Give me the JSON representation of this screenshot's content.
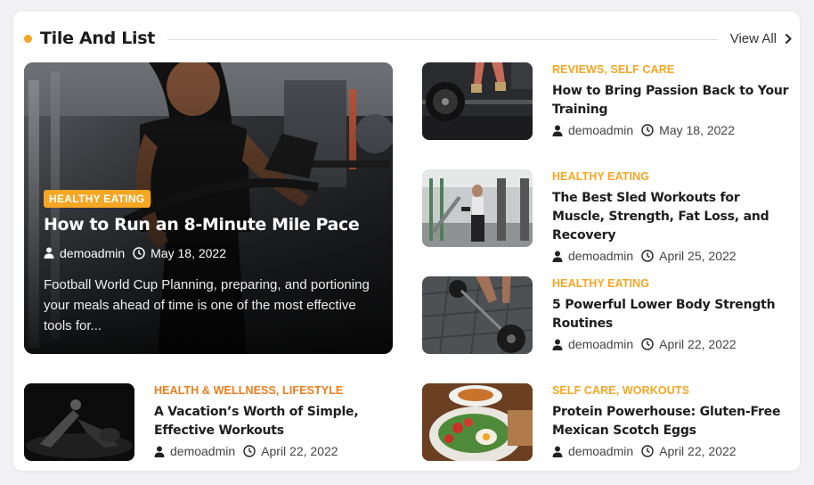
{
  "section": {
    "title": "Tile And List",
    "view_all": "View All",
    "accent_color": "#f5a623"
  },
  "featured": {
    "category": "HEALTHY EATING",
    "title": "How to Run an 8-Minute Mile Pace",
    "author": "demoadmin",
    "date": "May 18, 2022",
    "excerpt": "Football World Cup Planning, preparing, and portioning your meals ahead of time is one of the most effective tools for...",
    "image": "man-on-treadmill-photo"
  },
  "list": [
    {
      "categories": [
        "REVIEWS",
        "SELF CARE"
      ],
      "title": "How to Bring Passion Back to Your Training",
      "author": "demoadmin",
      "date": "May 18, 2022",
      "image": "barbell-deadlift-photo"
    },
    {
      "categories": [
        "HEALTHY EATING"
      ],
      "title": "The Best Sled Workouts for Muscle, Strength, Fat Loss, and Recovery",
      "author": "demoadmin",
      "date": "April 25, 2022",
      "image": "gym-woman-dumbbells-photo"
    },
    {
      "categories": [
        "HEALTHY EATING"
      ],
      "title": "5 Powerful Lower Body Strength Routines",
      "author": "demoadmin",
      "date": "April 22, 2022",
      "image": "barbell-floor-photo"
    },
    {
      "categories": [
        "HEALTH & WELLNESS",
        "LIFESTYLE"
      ],
      "title": "A Vacation’s Worth of Simple, Effective Workouts",
      "author": "demoadmin",
      "date": "April 22, 2022",
      "image": "dark-workout-photo"
    },
    {
      "categories": [
        "SELF CARE",
        "WORKOUTS"
      ],
      "title": "Protein Powerhouse: Gluten-Free Mexican Scotch Eggs",
      "author": "demoadmin",
      "date": "April 22, 2022",
      "image": "salad-plate-photo"
    }
  ],
  "icons": {
    "author": "user-icon",
    "date": "clock-icon",
    "view_all": "chevron-right-icon"
  },
  "colors": {
    "category": "#f5a623",
    "category_alt": "#ec7d1d",
    "title": "#1d1d1d",
    "meta": "#444444"
  }
}
